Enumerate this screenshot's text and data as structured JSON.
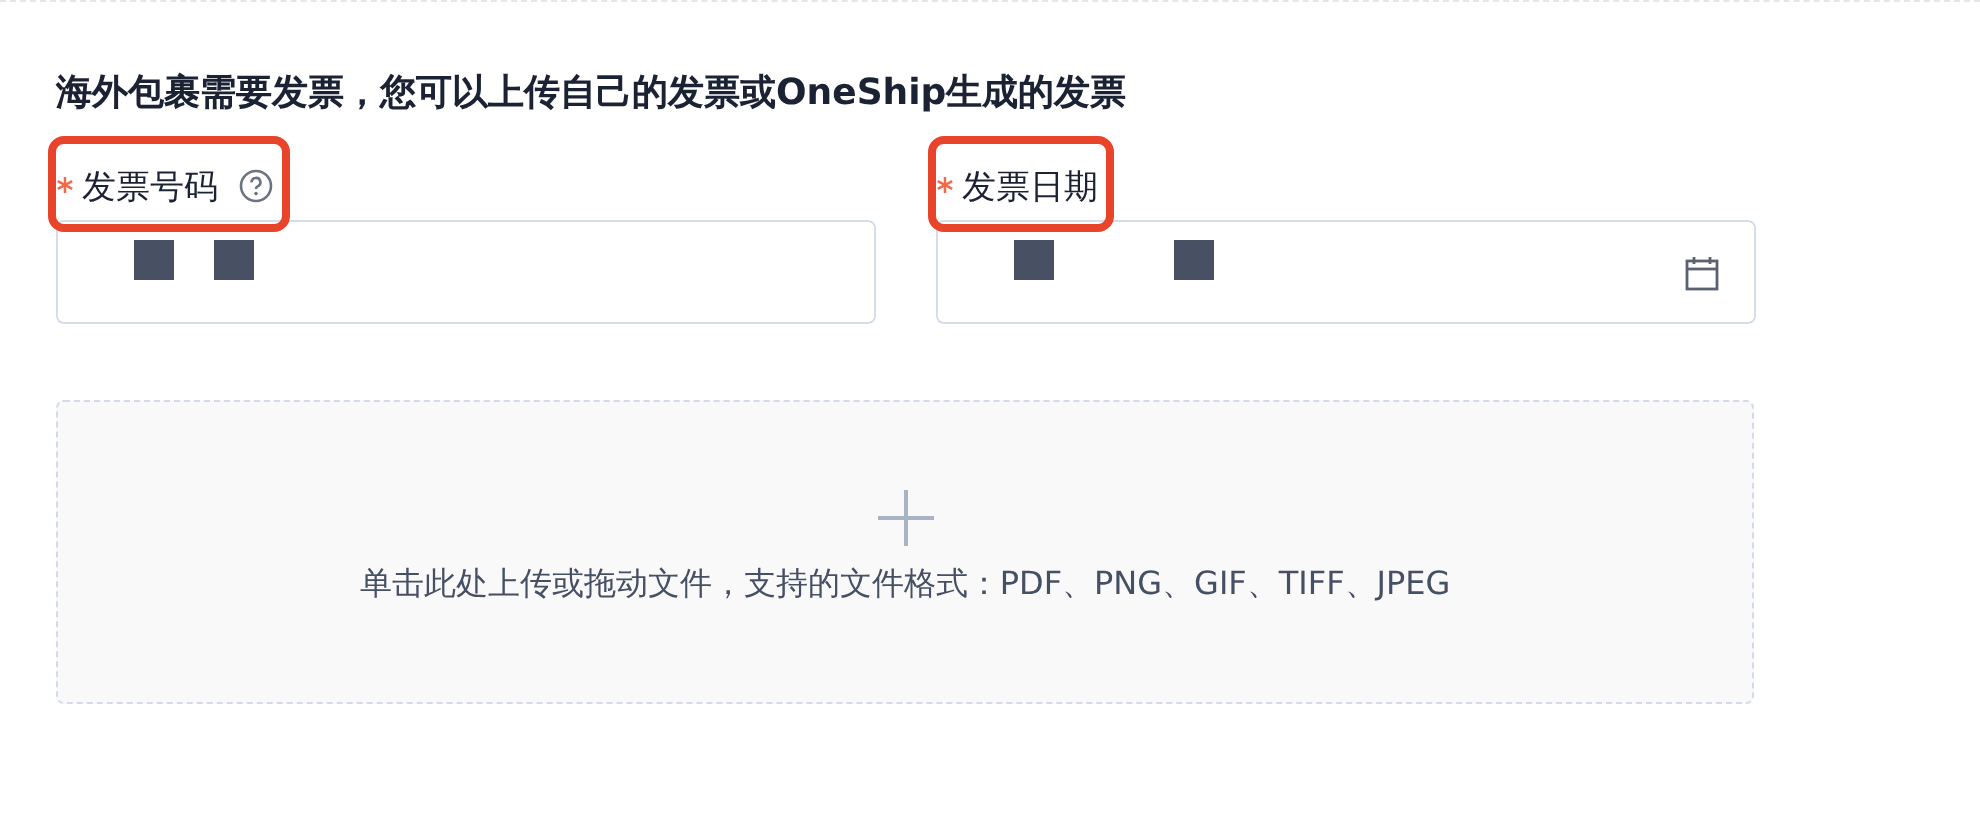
{
  "heading": "海外包裹需要发票，您可以上传自己的发票或OneShip生成的发票",
  "fields": [
    {
      "label": "发票号码",
      "required": true,
      "help": true,
      "highlighted": true,
      "kind": "text"
    },
    {
      "label": "发票日期",
      "required": true,
      "help": false,
      "highlighted": true,
      "kind": "date"
    }
  ],
  "upload": {
    "hint": "单击此处上传或拖动文件，支持的文件格式：PDF、PNG、GIF、TIFF、JPEG"
  }
}
